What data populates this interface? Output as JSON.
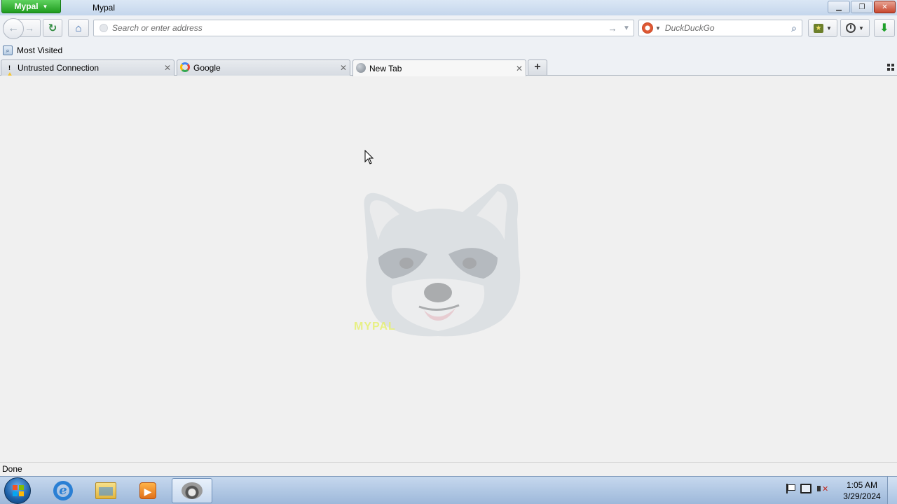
{
  "titlebar": {
    "app_menu_label": "Mypal",
    "window_title": "Mypal",
    "controls": [
      "minimize",
      "restore",
      "close"
    ]
  },
  "navbar": {
    "url_placeholder": "Search or enter address",
    "search_engine": "DuckDuckGo",
    "search_placeholder": "DuckDuckGo",
    "icons": {
      "back": "back-arrow-icon",
      "forward": "forward-arrow-icon",
      "reload": "reload-icon",
      "home": "home-icon",
      "go": "go-arrow-icon",
      "search": "magnifier-icon",
      "bookmarks": "bookmarks-star-icon",
      "history": "history-clock-icon",
      "downloads": "download-arrow-icon"
    }
  },
  "bookmarks_toolbar": {
    "items": [
      {
        "label": "Most Visited",
        "icon": "most-visited-icon"
      }
    ]
  },
  "tabs": [
    {
      "title": "Untrusted Connection",
      "icon": "warning-icon",
      "selected": false
    },
    {
      "title": "Google",
      "icon": "google-icon",
      "selected": false
    },
    {
      "title": "New Tab",
      "icon": "globe-icon",
      "selected": true
    }
  ],
  "content": {
    "background_image": "raccoon-logo",
    "watermark_text": "MYPAL"
  },
  "statusbar": {
    "text": "Done"
  },
  "taskbar": {
    "pinned": [
      "start-button",
      "internet-explorer",
      "file-explorer",
      "media-player",
      "mypal"
    ],
    "active": "mypal",
    "time": "1:05 AM",
    "date": "3/29/2024",
    "tray_icons": [
      "action-center-flag-icon",
      "network-icon",
      "volume-muted-icon"
    ]
  },
  "colors": {
    "app_button": "#1f9b1f",
    "titlebar": "#c4d6ec",
    "content_bg": "#f0f0f0",
    "taskbar": "#9db8da"
  }
}
